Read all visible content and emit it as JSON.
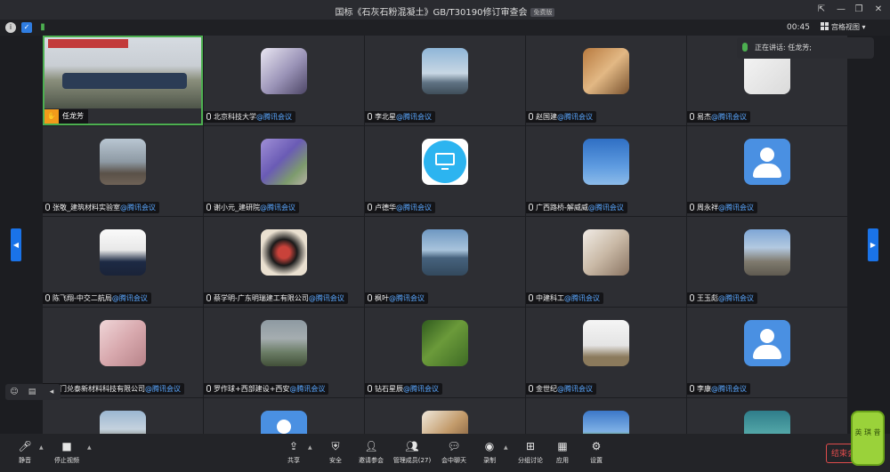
{
  "window": {
    "title": "国标《石灰石粉混凝土》GB/T30190修订审查会",
    "free_tag": "免费版",
    "controls": [
      "⇱",
      "—",
      "❐",
      "✕"
    ]
  },
  "info_bar": {
    "timer": "00:45",
    "view_label": "宫格视图 ▾"
  },
  "speaking": {
    "label": "正在讲话: 任龙芳;"
  },
  "speaker": {
    "name": "任龙芳"
  },
  "name_suffix": "@腾讯会议",
  "participants": [
    {
      "name": "北京科技大学",
      "avatar": "girl-photo"
    },
    {
      "name": "李北星",
      "avatar": "bridge-photo"
    },
    {
      "name": "赵国建",
      "avatar": "dog-photo"
    },
    {
      "name": "易杰",
      "avatar": "sketch-face"
    },
    {
      "name": "张敬_建筑材料实验室",
      "avatar": "road-photo"
    },
    {
      "name": "谢小元_建研院",
      "avatar": "jacaranda-photo"
    },
    {
      "name": "卢德华",
      "avatar": "screen-share-icon"
    },
    {
      "name": "广西路桥-解威威",
      "avatar": "sky-photo"
    },
    {
      "name": "周永祥",
      "avatar": "default-user"
    },
    {
      "name": "陈飞翔-中交二航局",
      "avatar": "man-portrait"
    },
    {
      "name": "蔡学明-广东明瑞建工有限公司",
      "avatar": "koi-art"
    },
    {
      "name": "枫叶",
      "avatar": "seaside-photo"
    },
    {
      "name": "中建科工",
      "avatar": "cat-photo"
    },
    {
      "name": "王玉彪",
      "avatar": "mountain-photo"
    },
    {
      "name": "厦门兑泰新材料科技有限公司",
      "avatar": "fist-photo"
    },
    {
      "name": "罗作球+西部建设+西安",
      "avatar": "misty-hills-photo"
    },
    {
      "name": "钻石星辰",
      "avatar": "forest-photo"
    },
    {
      "name": "金世纪",
      "avatar": "house-sketch"
    },
    {
      "name": "李康",
      "avatar": "default-user"
    },
    {
      "name": "",
      "avatar": "great-wall-photo"
    },
    {
      "name": "",
      "avatar": "default-user"
    },
    {
      "name": "",
      "avatar": "child-photo"
    },
    {
      "name": "",
      "avatar": "field-photo"
    },
    {
      "name": "",
      "avatar": "dancer-photo"
    }
  ],
  "toolbar": {
    "mute": "静音",
    "stop_video": "停止视频",
    "share": "共享",
    "security": "安全",
    "invite": "邀请参会",
    "manage_members": "管理成员(27)",
    "chat": "会中聊天",
    "record": "录制",
    "breakout": "分组讨论",
    "apps": "应用",
    "settings": "设置",
    "end": "结束会议"
  },
  "stamp_text": "英 琪 昔",
  "colors": {
    "accent_blue": "#1a73e8",
    "name_suffix_blue": "#5aa7ff",
    "speaker_border": "#4caf50",
    "end_red": "#e04c4c",
    "default_avatar_blue": "#4a90e2"
  }
}
